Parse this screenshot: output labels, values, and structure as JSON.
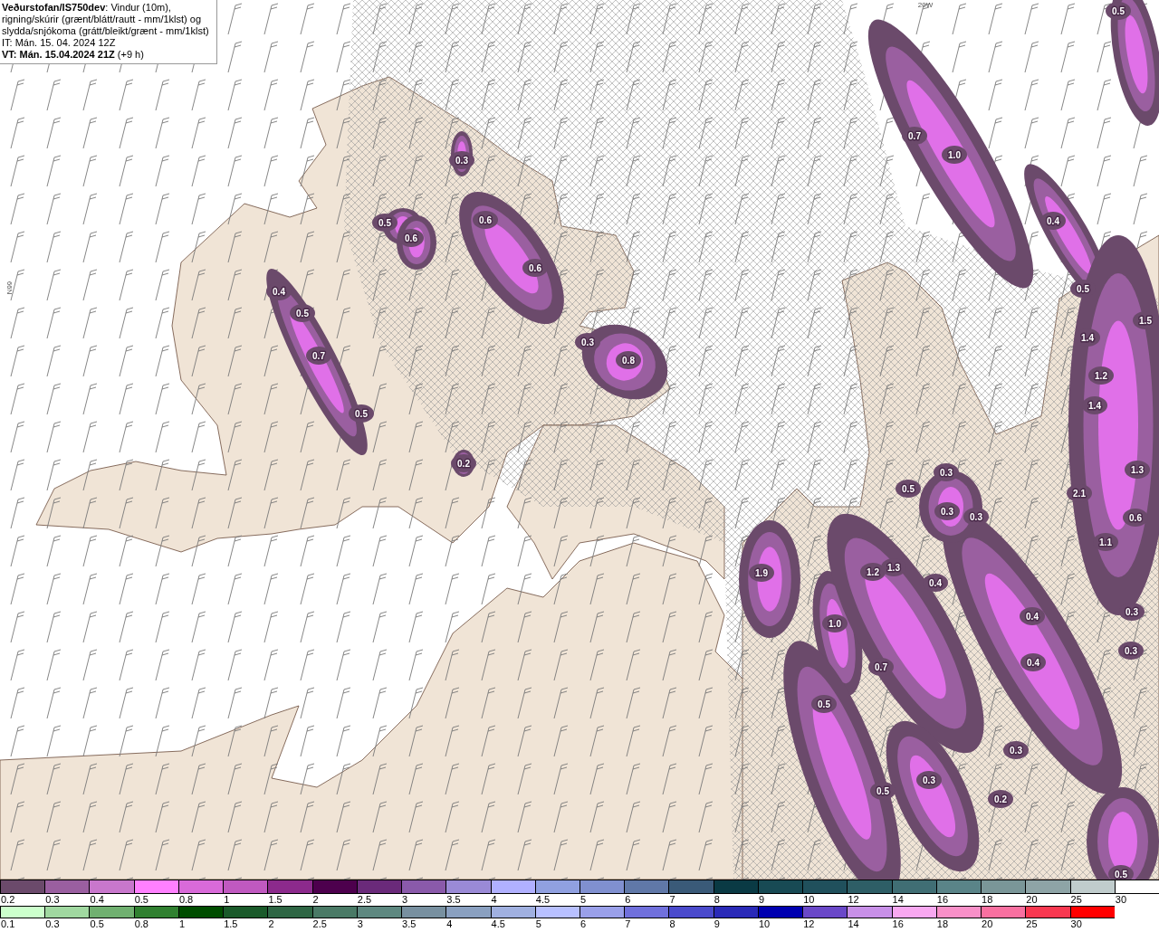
{
  "map": {
    "title_box": {
      "heading": "**Veðurstofan/IS750dev**: Vindur (10m), rigning/skúrir (grænt/blátt/rautt - mm/1klst) og slydda/snjókoma (grátt/bleikt/grænt - mm/1klst)",
      "issue_time": "IT: Mán. 15. 04. 2024 12Z",
      "valid_time": "**VT: Mán. 15.04.2024 21Z** (+9 h)"
    },
    "longitude_label": "20W",
    "latitude_label": "66N",
    "precip_labels": [
      "0.3",
      "0.5",
      "0.6",
      "0.6",
      "0.6",
      "0.4",
      "0.5",
      "0.7",
      "0.5",
      "0.3",
      "0.8",
      "0.2",
      "0.7",
      "1.0",
      "0.5",
      "0.4",
      "0.5",
      "1.5",
      "1.4",
      "1.2",
      "1.4",
      "1.3",
      "2.1",
      "0.6",
      "1.1",
      "0.3",
      "0.5",
      "0.3",
      "0.3",
      "1.9",
      "1.2",
      "1.3",
      "0.4",
      "1.0",
      "0.4",
      "0.4",
      "0.7",
      "0.3",
      "0.3",
      "0.5",
      "0.3",
      "0.3",
      "0.2",
      "0.5",
      "0.5"
    ]
  },
  "legend": {
    "snow_scale": [
      {
        "label": "0.2",
        "color": "#6b4a6b"
      },
      {
        "label": "0.3",
        "color": "#9a5fa0"
      },
      {
        "label": "0.4",
        "color": "#c877cc"
      },
      {
        "label": "0.5",
        "color": "#ff80ff"
      },
      {
        "label": "0.8",
        "color": "#d96ad9"
      },
      {
        "label": "1",
        "color": "#c059c0"
      },
      {
        "label": "1.5",
        "color": "#8c2a8c"
      },
      {
        "label": "2",
        "color": "#4d004d"
      },
      {
        "label": "2.5",
        "color": "#6a2a7a"
      },
      {
        "label": "3",
        "color": "#8a5aaa"
      },
      {
        "label": "3.5",
        "color": "#9a8ad6"
      },
      {
        "label": "4",
        "color": "#b0b0ff"
      },
      {
        "label": "4.5",
        "color": "#90a0e0"
      },
      {
        "label": "5",
        "color": "#8090d0"
      },
      {
        "label": "6",
        "color": "#6078a8"
      },
      {
        "label": "7",
        "color": "#3a5a78"
      },
      {
        "label": "8",
        "color": "#0a3a44"
      },
      {
        "label": "9",
        "color": "#184a54"
      },
      {
        "label": "10",
        "color": "#20505c"
      },
      {
        "label": "12",
        "color": "#2e5e66"
      },
      {
        "label": "14",
        "color": "#406e74"
      },
      {
        "label": "16",
        "color": "#5a8488"
      },
      {
        "label": "18",
        "color": "#7a9698"
      },
      {
        "label": "20",
        "color": "#8ea4a6"
      },
      {
        "label": "25",
        "color": "#c0cccc"
      },
      {
        "label": "30",
        "color": "#ffffff"
      }
    ],
    "rain_scale": [
      {
        "label": "0.1",
        "color": "#ccffcc"
      },
      {
        "label": "0.3",
        "color": "#a0d8a0"
      },
      {
        "label": "0.5",
        "color": "#70b070"
      },
      {
        "label": "0.8",
        "color": "#308030"
      },
      {
        "label": "1",
        "color": "#004d00"
      },
      {
        "label": "1.5",
        "color": "#1a5a2a"
      },
      {
        "label": "2",
        "color": "#2e6644"
      },
      {
        "label": "2.5",
        "color": "#4a7a66"
      },
      {
        "label": "3",
        "color": "#5e8880"
      },
      {
        "label": "3.5",
        "color": "#7890a0"
      },
      {
        "label": "4",
        "color": "#8aa0c0"
      },
      {
        "label": "4.5",
        "color": "#a0b0e0"
      },
      {
        "label": "5",
        "color": "#b8c0ff"
      },
      {
        "label": "6",
        "color": "#9aa0ea"
      },
      {
        "label": "7",
        "color": "#7070dc"
      },
      {
        "label": "8",
        "color": "#4a4acc"
      },
      {
        "label": "9",
        "color": "#2a2ab8"
      },
      {
        "label": "10",
        "color": "#0000b0"
      },
      {
        "label": "12",
        "color": "#6a48c8"
      },
      {
        "label": "14",
        "color": "#c890e8"
      },
      {
        "label": "16",
        "color": "#f8a8f0"
      },
      {
        "label": "18",
        "color": "#f890c8"
      },
      {
        "label": "20",
        "color": "#f870a0"
      },
      {
        "label": "25",
        "color": "#f83850"
      },
      {
        "label": "30",
        "color": "#ff0000"
      }
    ]
  }
}
